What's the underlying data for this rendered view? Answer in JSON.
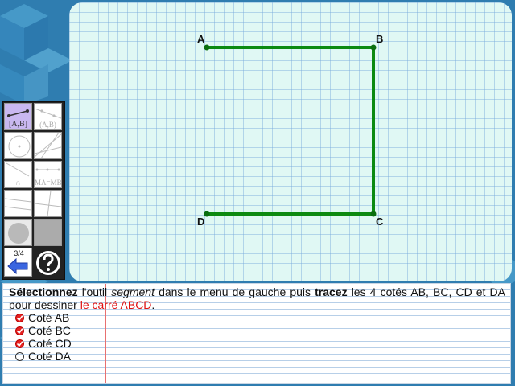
{
  "canvas": {
    "points": [
      {
        "label": "A"
      },
      {
        "label": "B"
      },
      {
        "label": "C"
      },
      {
        "label": "D"
      }
    ],
    "segment_color": "#0d8a12",
    "point_color": "#0a6e0f"
  },
  "toolbar": {
    "tools": [
      {
        "name": "segment-tool",
        "label": "[A,B]",
        "selected": true
      },
      {
        "name": "line-tool",
        "label": "(A,B)",
        "selected": false
      },
      {
        "name": "circle-tool",
        "label": "",
        "selected": false
      },
      {
        "name": "lines-tool",
        "label": "",
        "selected": false
      },
      {
        "name": "intersection-tool",
        "label": "∩",
        "selected": false
      },
      {
        "name": "midpoint-tool",
        "label": "MA=MB",
        "selected": false
      },
      {
        "name": "parallel-tool",
        "label": "",
        "selected": false
      },
      {
        "name": "perpendicular-tool",
        "label": "",
        "selected": false
      },
      {
        "name": "color-tool",
        "label": "",
        "selected": false
      },
      {
        "name": "fill-tool",
        "label": "",
        "selected": false
      }
    ],
    "page_counter": "3/4"
  },
  "instructions": {
    "verb1": "Sélectionnez",
    "text1": " l'outil ",
    "tool_name": "segment",
    "text2": " dans le menu de gauche puis ",
    "verb2": "tracez",
    "text3": " les 4 cotés AB, BC, CD et DA pour dessiner ",
    "highlight": "le carré ABCD",
    "text4": ".",
    "checklist": [
      {
        "label": "Coté AB",
        "done": true
      },
      {
        "label": "Coté BC",
        "done": true
      },
      {
        "label": "Coté CD",
        "done": true
      },
      {
        "label": "Coté DA",
        "done": false
      }
    ]
  }
}
